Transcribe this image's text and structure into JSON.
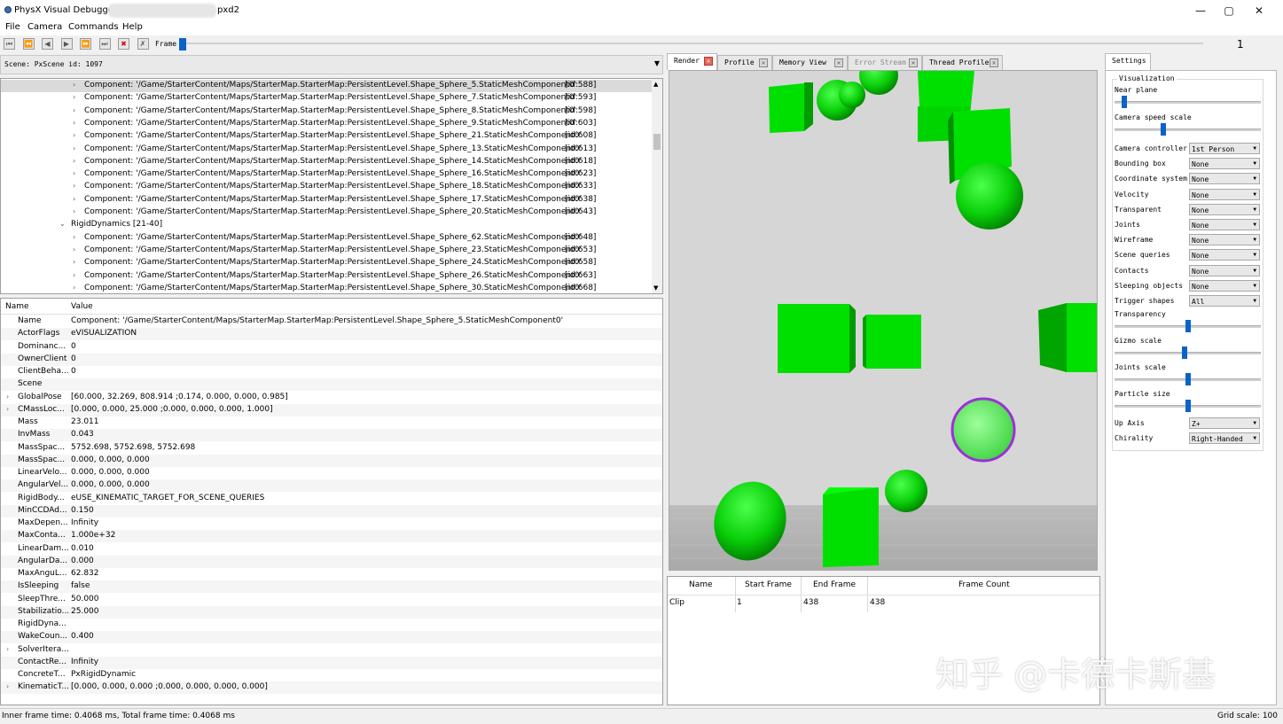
{
  "window": {
    "title": "PhysX Visual Debugger",
    "title_suffix": "pxd2",
    "minimize_glyph": "—",
    "maximize_glyph": "▢",
    "close_glyph": "✕"
  },
  "menu": [
    "File",
    "Camera",
    "Commands",
    "Help"
  ],
  "toolbar": {
    "buttons": [
      {
        "name": "first-frame-icon",
        "glyph": "⏮"
      },
      {
        "name": "step-back-icon",
        "glyph": "⏪"
      },
      {
        "name": "prev-frame-icon",
        "glyph": "◀"
      },
      {
        "name": "play-icon",
        "glyph": "▶"
      },
      {
        "name": "next-frame-icon",
        "glyph": "⏩"
      },
      {
        "name": "last-frame-icon",
        "glyph": "⏭"
      },
      {
        "name": "stop-icon",
        "glyph": "✖"
      },
      {
        "name": "disconnect-icon",
        "glyph": "✗"
      }
    ],
    "frame_label": "Frame",
    "frame_value": "1",
    "frame_progress": 0.0
  },
  "scene": {
    "label": "Scene: PxScene id: 1097"
  },
  "tree": {
    "rows": [
      {
        "indent": 2,
        "caret": "›",
        "text": "Component: '/Game/StarterContent/Maps/StarterMap.StarterMap:PersistentLevel.Shape_Sphere_5.StaticMeshComponent0'",
        "id": "[id:588]",
        "selected": true
      },
      {
        "indent": 2,
        "caret": "›",
        "text": "Component: '/Game/StarterContent/Maps/StarterMap.StarterMap:PersistentLevel.Shape_Sphere_7.StaticMeshComponent0'",
        "id": "[id:593]"
      },
      {
        "indent": 2,
        "caret": "›",
        "text": "Component: '/Game/StarterContent/Maps/StarterMap.StarterMap:PersistentLevel.Shape_Sphere_8.StaticMeshComponent0'",
        "id": "[id:598]"
      },
      {
        "indent": 2,
        "caret": "›",
        "text": "Component: '/Game/StarterContent/Maps/StarterMap.StarterMap:PersistentLevel.Shape_Sphere_9.StaticMeshComponent0'",
        "id": "[id:603]"
      },
      {
        "indent": 2,
        "caret": "›",
        "text": "Component: '/Game/StarterContent/Maps/StarterMap.StarterMap:PersistentLevel.Shape_Sphere_21.StaticMeshComponent0'",
        "id": "[id:608]"
      },
      {
        "indent": 2,
        "caret": "›",
        "text": "Component: '/Game/StarterContent/Maps/StarterMap.StarterMap:PersistentLevel.Shape_Sphere_13.StaticMeshComponent0'",
        "id": "[id:613]"
      },
      {
        "indent": 2,
        "caret": "›",
        "text": "Component: '/Game/StarterContent/Maps/StarterMap.StarterMap:PersistentLevel.Shape_Sphere_14.StaticMeshComponent0'",
        "id": "[id:618]"
      },
      {
        "indent": 2,
        "caret": "›",
        "text": "Component: '/Game/StarterContent/Maps/StarterMap.StarterMap:PersistentLevel.Shape_Sphere_16.StaticMeshComponent0'",
        "id": "[id:623]"
      },
      {
        "indent": 2,
        "caret": "›",
        "text": "Component: '/Game/StarterContent/Maps/StarterMap.StarterMap:PersistentLevel.Shape_Sphere_18.StaticMeshComponent0'",
        "id": "[id:633]"
      },
      {
        "indent": 2,
        "caret": "›",
        "text": "Component: '/Game/StarterContent/Maps/StarterMap.StarterMap:PersistentLevel.Shape_Sphere_17.StaticMeshComponent0'",
        "id": "[id:638]"
      },
      {
        "indent": 2,
        "caret": "›",
        "text": "Component: '/Game/StarterContent/Maps/StarterMap.StarterMap:PersistentLevel.Shape_Sphere_20.StaticMeshComponent0'",
        "id": "[id:643]"
      },
      {
        "indent": 1,
        "caret": "⌄",
        "text": "RigidDynamics [21-40]",
        "id": ""
      },
      {
        "indent": 2,
        "caret": "›",
        "text": "Component: '/Game/StarterContent/Maps/StarterMap.StarterMap:PersistentLevel.Shape_Sphere_62.StaticMeshComponent0'",
        "id": "[id:648]"
      },
      {
        "indent": 2,
        "caret": "›",
        "text": "Component: '/Game/StarterContent/Maps/StarterMap.StarterMap:PersistentLevel.Shape_Sphere_23.StaticMeshComponent0'",
        "id": "[id:653]"
      },
      {
        "indent": 2,
        "caret": "›",
        "text": "Component: '/Game/StarterContent/Maps/StarterMap.StarterMap:PersistentLevel.Shape_Sphere_24.StaticMeshComponent0'",
        "id": "[id:658]"
      },
      {
        "indent": 2,
        "caret": "›",
        "text": "Component: '/Game/StarterContent/Maps/StarterMap.StarterMap:PersistentLevel.Shape_Sphere_26.StaticMeshComponent0'",
        "id": "[id:663]"
      },
      {
        "indent": 2,
        "caret": "›",
        "text": "Component: '/Game/StarterContent/Maps/StarterMap.StarterMap:PersistentLevel.Shape_Sphere_30.StaticMeshComponent0'",
        "id": "[id:668]"
      }
    ]
  },
  "properties": {
    "header_name": "Name",
    "header_value": "Value",
    "rows": [
      {
        "name": "Name",
        "value": "Component: '/Game/StarterContent/Maps/StarterMap.StarterMap:PersistentLevel.Shape_Sphere_5.StaticMeshComponent0'",
        "expandable": false
      },
      {
        "name": "ActorFlags",
        "value": "eVISUALIZATION",
        "expandable": false
      },
      {
        "name": "Dominanc...",
        "value": "0",
        "expandable": false
      },
      {
        "name": "OwnerClient",
        "value": "0",
        "expandable": false
      },
      {
        "name": "ClientBeha...",
        "value": "0",
        "expandable": false
      },
      {
        "name": "Scene",
        "value": "",
        "expandable": false
      },
      {
        "name": "GlobalPose",
        "value": "[60.000, 32.269, 808.914 ;0.174, 0.000, 0.000, 0.985]",
        "expandable": true
      },
      {
        "name": "CMassLoc...",
        "value": "[0.000, 0.000, 25.000 ;0.000, 0.000, 0.000, 1.000]",
        "expandable": true
      },
      {
        "name": "Mass",
        "value": "23.011",
        "expandable": false
      },
      {
        "name": "InvMass",
        "value": "0.043",
        "expandable": false
      },
      {
        "name": "MassSpac...",
        "value": "5752.698, 5752.698, 5752.698",
        "expandable": false
      },
      {
        "name": "MassSpac...",
        "value": "0.000, 0.000, 0.000",
        "expandable": false
      },
      {
        "name": "LinearVelo...",
        "value": "0.000, 0.000, 0.000",
        "expandable": false
      },
      {
        "name": "AngularVel...",
        "value": "0.000, 0.000, 0.000",
        "expandable": false
      },
      {
        "name": "RigidBody...",
        "value": "eUSE_KINEMATIC_TARGET_FOR_SCENE_QUERIES",
        "expandable": false
      },
      {
        "name": "MinCCDAd...",
        "value": "0.150",
        "expandable": false
      },
      {
        "name": "MaxDepen...",
        "value": "Infinity",
        "expandable": false
      },
      {
        "name": "MaxConta...",
        "value": "1.000e+32",
        "expandable": false
      },
      {
        "name": "LinearDam...",
        "value": "0.010",
        "expandable": false
      },
      {
        "name": "AngularDa...",
        "value": "0.000",
        "expandable": false
      },
      {
        "name": "MaxAnguL...",
        "value": "62.832",
        "expandable": false
      },
      {
        "name": "IsSleeping",
        "value": "false",
        "expandable": false
      },
      {
        "name": "SleepThre...",
        "value": "50.000",
        "expandable": false
      },
      {
        "name": "Stabilizatio...",
        "value": "25.000",
        "expandable": false
      },
      {
        "name": "RigidDyna...",
        "value": "",
        "expandable": false
      },
      {
        "name": "WakeCoun...",
        "value": "0.400",
        "expandable": false
      },
      {
        "name": "SolverItera...",
        "value": "",
        "expandable": true
      },
      {
        "name": "ContactRe...",
        "value": "Infinity",
        "expandable": false
      },
      {
        "name": "ConcreteT...",
        "value": "PxRigidDynamic",
        "expandable": false
      },
      {
        "name": "KinematicT...",
        "value": "[0.000, 0.000, 0.000 ;0.000, 0.000, 0.000, 0.000]",
        "expandable": true
      }
    ]
  },
  "tabs": [
    {
      "label": "Render",
      "active": true,
      "disabled": false
    },
    {
      "label": "Profile",
      "active": false,
      "disabled": false
    },
    {
      "label": "Memory View",
      "active": false,
      "disabled": false
    },
    {
      "label": "Error Stream",
      "active": false,
      "disabled": true
    },
    {
      "label": "Thread Profiler",
      "active": false,
      "disabled": false
    }
  ],
  "clips": {
    "headers": [
      "Name",
      "Start Frame",
      "End Frame",
      "Frame Count"
    ],
    "rows": [
      [
        "Clip",
        "1",
        "438",
        "438"
      ]
    ]
  },
  "settings": {
    "tab_label": "Settings",
    "group_title": "Visualization",
    "sliders_top": [
      {
        "label": "Near plane",
        "value": 0.05
      },
      {
        "label": "Camera speed scale",
        "value": 0.33
      }
    ],
    "combos": [
      {
        "label": "Camera controller",
        "value": "1st Person"
      },
      {
        "label": "Bounding box",
        "value": "None"
      },
      {
        "label": "Coordinate system",
        "value": "None"
      },
      {
        "label": "Velocity",
        "value": "None"
      },
      {
        "label": "Transparent",
        "value": "None"
      },
      {
        "label": "Joints",
        "value": "None"
      },
      {
        "label": "Wireframe",
        "value": "None"
      },
      {
        "label": "Scene queries",
        "value": "None"
      },
      {
        "label": "Contacts",
        "value": "None"
      },
      {
        "label": "Sleeping objects",
        "value": "None"
      },
      {
        "label": "Trigger shapes",
        "value": "All"
      }
    ],
    "sliders_mid": [
      {
        "label": "Transparency",
        "value": 0.5
      },
      {
        "label": "Gizmo scale",
        "value": 0.48
      },
      {
        "label": "Joints scale",
        "value": 0.5
      },
      {
        "label": "Particle size",
        "value": 0.5
      }
    ],
    "combos_bottom": [
      {
        "label": "Up Axis",
        "value": "Z+"
      },
      {
        "label": "Chirality",
        "value": "Right-Handed"
      }
    ]
  },
  "status": {
    "text": "Inner frame time: 0.4068 ms, Total frame time: 0.4068 ms",
    "grid_scale": "Grid scale: 100"
  },
  "watermark": "知乎 @卡德卡斯基",
  "colors": {
    "accent": "#0a64c8",
    "object_green": "#00e000",
    "selection_outline": "#9b30d9"
  }
}
